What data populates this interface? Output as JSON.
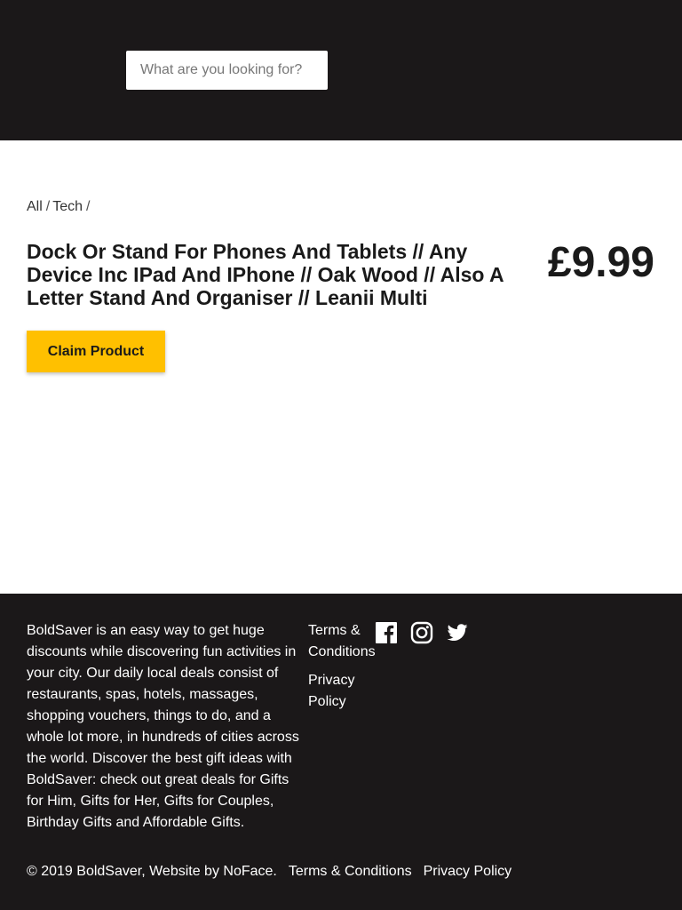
{
  "header": {
    "search": {
      "placeholder": "What are you looking for?"
    }
  },
  "breadcrumb": {
    "items": [
      "All",
      "Tech"
    ],
    "separator": "/"
  },
  "product": {
    "title": "Dock Or Stand For Phones And Tablets // Any Device Inc IPad And IPhone // Oak Wood // Also A Letter Stand And Organiser // Leanii Multi",
    "price": "£9.99",
    "claim_label": "Claim Product"
  },
  "footer": {
    "about": "BoldSaver is an easy way to get huge discounts while discovering fun activities in your city. Our daily local deals consist of restaurants, spas, hotels, massages, shopping vouchers, things to do, and a whole lot more, in hundreds of cities across the world. Discover the best gift ideas with BoldSaver: check out great deals for Gifts for Him, Gifts for Her, Gifts for Couples, Birthday Gifts and Affordable Gifts.",
    "links": [
      "Terms & Conditions",
      "Privacy Policy"
    ],
    "social_icons": [
      "facebook-icon",
      "instagram-icon",
      "twitter-icon"
    ],
    "copyright": "© 2019 BoldSaver, Website by NoFace.",
    "bottom_links": [
      "Terms & Conditions",
      "Privacy Policy"
    ]
  },
  "colors": {
    "dark_background": "#1b1819",
    "accent": "#ffc000"
  }
}
